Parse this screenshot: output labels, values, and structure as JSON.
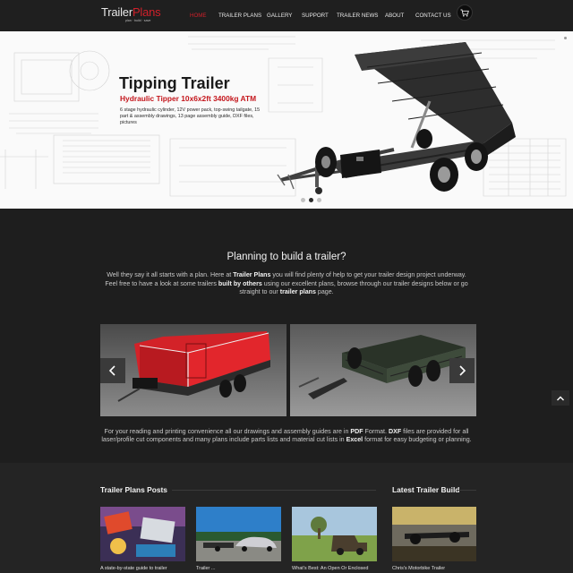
{
  "header": {
    "logo": {
      "brand_white": "Trailer",
      "brand_red": "Plans",
      "tagline": "plan · build · save"
    },
    "nav": [
      {
        "label": "HOME",
        "active": true
      },
      {
        "label": "TRAILER PLANS",
        "active": false
      },
      {
        "label": "GALLERY",
        "active": false
      },
      {
        "label": "SUPPORT",
        "active": false
      },
      {
        "label": "TRAILER NEWS",
        "active": false
      },
      {
        "label": "ABOUT",
        "active": false
      },
      {
        "label": "CONTACT US",
        "active": false
      }
    ],
    "cart_icon": "cart-icon"
  },
  "hero": {
    "title": "Tipping Trailer",
    "subtitle": "Hydraulic Tipper 10x6x2ft 3400kg ATM",
    "description": "6 stage hydraulic cylinder, 12V power pack, top-swing tailgate, 15 part & assembly drawings, 13 page assembly guide, DXF files, pictures",
    "slides": 3,
    "active_slide": 1
  },
  "intro": {
    "title": "Planning to build a trailer?",
    "p1": "Well they say it all starts with a plan. Here at ",
    "b1": "Trailer Plans",
    "p2": " you will find plenty of help to get your trailer design project underway. Feel free to have a look at some trailers ",
    "b2": "built by others",
    "p3": " using our excellent plans, browse through our trailer designs below or go straight to our ",
    "b3": "trailer plans",
    "p4": " page."
  },
  "gallery": {
    "prev_icon": "chevron-left-icon",
    "next_icon": "chevron-right-icon"
  },
  "footnote": {
    "p1": "For your reading and printing convenience all our drawings and assembly guides are in ",
    "b1": "PDF",
    "p2": " Format. ",
    "b2": "DXF",
    "p3": " files are provided for all laser/profile cut components and many plans include parts lists and material cut lists in ",
    "b3": "Excel",
    "p4": " format for easy budgeting or planning."
  },
  "posts": {
    "title": "Trailer Plans Posts",
    "items": [
      {
        "caption": "A state-by-state guide to trailer"
      },
      {
        "caption": "Trailer ..."
      },
      {
        "caption": "What's Best: An Open Or Enclosed"
      }
    ]
  },
  "latest": {
    "title": "Latest Trailer Build",
    "caption": "Chris's Motorbike Trailer"
  },
  "colors": {
    "accent": "#d0202a",
    "background": "#1e1e1e"
  }
}
